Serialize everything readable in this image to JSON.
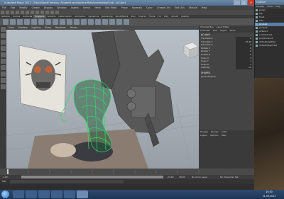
{
  "maya": {
    "title": "Autodesk Maya 2012 - Educational Version: /student work/scene files/scenes/skull.mb - pCube1",
    "menus": [
      "File",
      "Edit",
      "Modify",
      "Create",
      "Display",
      "Window",
      "Assets",
      "Select",
      "Mesh",
      "Edit Mesh",
      "Proxy",
      "Normals",
      "Color",
      "Create UVs",
      "Edit UVs",
      "Muscle",
      "Help"
    ],
    "shelf_tabs": [
      "General",
      "Curves",
      "Surfaces",
      "Polygons",
      "Subdivs",
      "Deformation",
      "Animation",
      "Dynamics",
      "Rendering",
      "PaintEffects",
      "Toon",
      "Muscle",
      "Fluids",
      "Fur",
      "Hair",
      "nCloth",
      "Custom"
    ],
    "active_shelf_tab": "Polygons",
    "view_menus": [
      "View",
      "Shading",
      "Lighting",
      "Show",
      "Renderer",
      "Panels"
    ],
    "right_panel": {
      "tabs": [
        "Channel Box",
        "Layer Editor"
      ],
      "menus": [
        "Channels",
        "Edit",
        "Object",
        "Show"
      ],
      "object_name": "pCube1",
      "channels": [
        {
          "name": "Translate X",
          "value": "0"
        },
        {
          "name": "Translate Y",
          "value": "15.49"
        },
        {
          "name": "Translate Z",
          "value": "0"
        },
        {
          "name": "Rotate X",
          "value": "0"
        },
        {
          "name": "Rotate Y",
          "value": "0"
        },
        {
          "name": "Rotate Z",
          "value": "0"
        },
        {
          "name": "Scale X",
          "value": "1"
        },
        {
          "name": "Scale Y",
          "value": "1"
        },
        {
          "name": "Scale Z",
          "value": "1"
        },
        {
          "name": "Visibility",
          "value": "on"
        }
      ],
      "shapes_label": "SHAPES",
      "shape_name": "pCubeShape1",
      "layer_tabs": [
        "Display",
        "Render",
        "Anim"
      ],
      "layer_menus": [
        "Layers",
        "Options",
        "Help"
      ]
    },
    "range": {
      "start": "1.00",
      "end": "24.00",
      "anim_end": "48.00",
      "layer": "No Anim Layer",
      "char": "No Character Set"
    },
    "command_label": "MEL"
  },
  "outliner": {
    "title": "Outliner",
    "menus": [
      "Display",
      "Show",
      "Help"
    ],
    "items": [
      "persp",
      "top",
      "front",
      "side",
      "pCube1",
      "pCube2",
      "pPlane1",
      "nurbsCircle1",
      "polySurface1",
      "defaultLightSet",
      "defaultObjectSet"
    ],
    "selected_index": 4
  },
  "taskbar": {
    "time": "16:30",
    "date": "21-03-2013"
  }
}
